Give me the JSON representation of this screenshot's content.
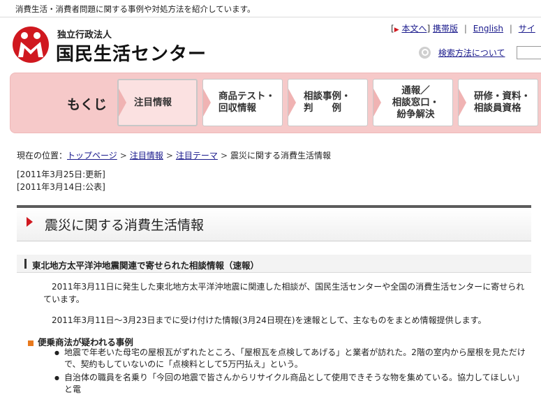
{
  "tagline": "消費生活・消費者問題に関する事例や対処方法を紹介しています。",
  "header": {
    "org_sub": "独立行政法人",
    "org_name": "国民生活センター",
    "utility": {
      "main_link": "本文へ",
      "mobile_link": "携帯版",
      "english_link": "English",
      "site_link": "サイ"
    },
    "search_help": "検索方法について",
    "brand_color": "#d0181f"
  },
  "nav": {
    "mokuji": "もくじ",
    "tabs": [
      {
        "label": "注目情報"
      },
      {
        "label": "商品テスト・\n回収情報"
      },
      {
        "label": "相談事例・\n判　　例"
      },
      {
        "label": "通報／\n相談窓口・\n紛争解決"
      },
      {
        "label": "研修・資料・\n相談員資格"
      }
    ]
  },
  "breadcrumb": {
    "prefix": "現在の位置：",
    "items": [
      "トップページ",
      "注目情報",
      "注目テーマ"
    ],
    "current": "震災に関する消費生活情報"
  },
  "dates": {
    "updated": "[2011年3月25日:更新]",
    "published": "[2011年3月14日:公表]"
  },
  "page_title": "震災に関する消費生活情報",
  "section": {
    "heading": "東北地方太平洋沖地震関連で寄せられた相談情報（速報）",
    "para1": "2011年3月11日に発生した東北地方太平洋沖地震に関連した相談が、国民生活センターや全国の消費生活センターに寄せられています。",
    "para2": "2011年3月11日～3月23日までに受け付けた情報(3月24日現在)を速報として、主なものをまとめ情報提供します。",
    "subheading": "便乗商法が疑われる事例",
    "bullets": [
      "地震で年老いた母宅の屋根瓦がずれたところ、「屋根瓦を点検してあげる」と業者が訪れた。2階の室内から屋根を見ただけで、契約もしていないのに「点検料として5万円払え」という。",
      "自治体の職員を名乗り「今回の地震で皆さんからリサイクル商品として使用できそうな物を集めている。協力してほしい」と電"
    ]
  }
}
